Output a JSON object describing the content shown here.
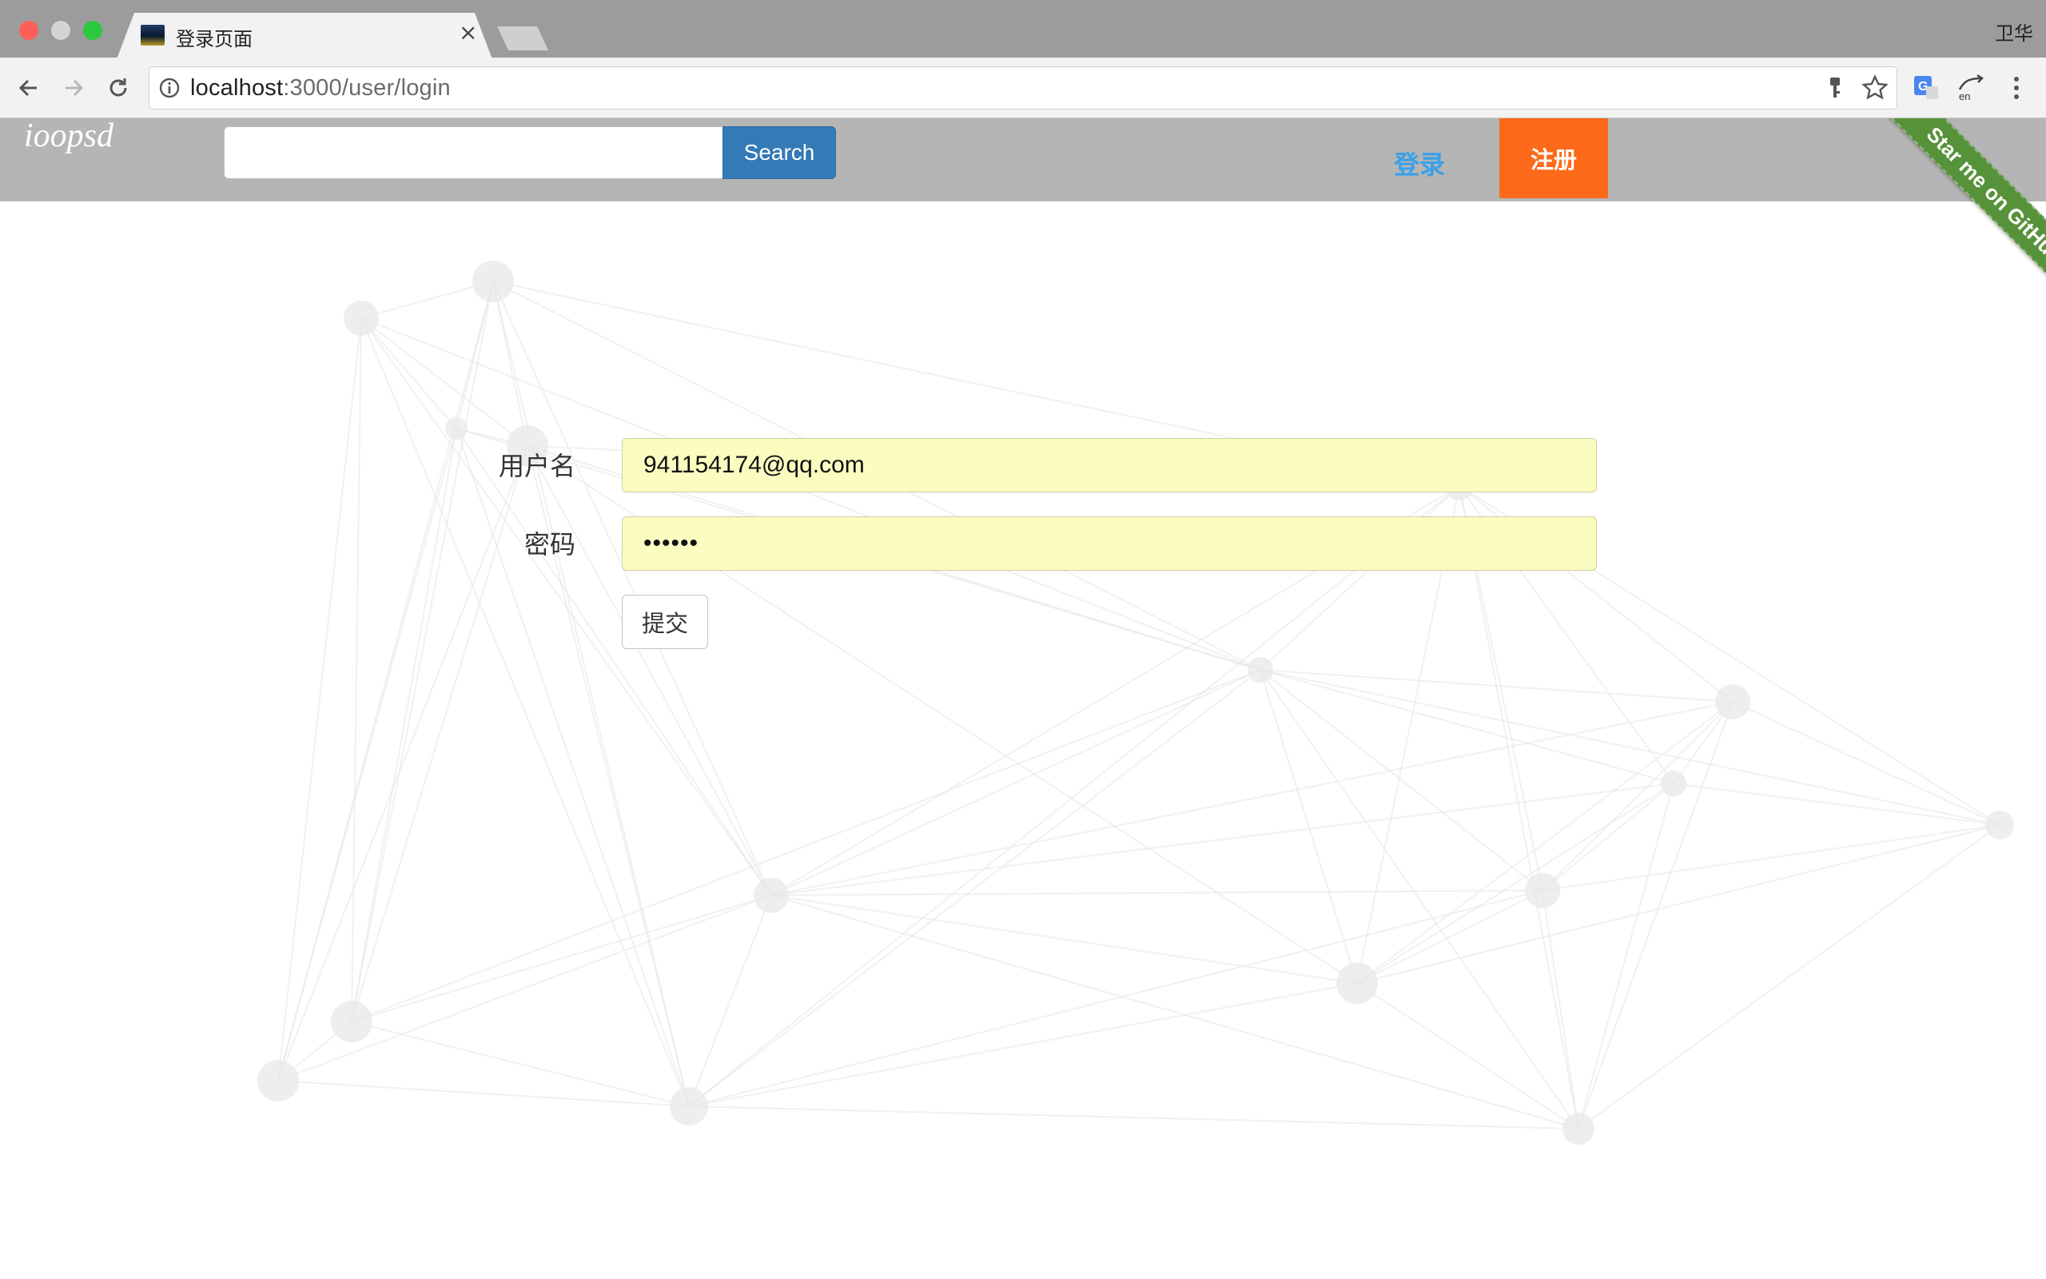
{
  "browser": {
    "tab_title": "登录页面",
    "tab_close": "×",
    "profile_name": "卫华",
    "url_host": "localhost",
    "url_path": ":3000/user/login"
  },
  "navbar": {
    "brand": "ioopsd",
    "search_button": "Search",
    "search_placeholder": "",
    "login_link": "登录",
    "register_button": "注册",
    "github_ribbon": "Star me on GitHub"
  },
  "form": {
    "username_label": "用户名",
    "username_value": "941154174@qq.com",
    "password_label": "密码",
    "password_value": "••••••",
    "submit_label": "提交"
  },
  "colors": {
    "navbar_bg": "#b5b5b5",
    "search_button_bg": "#337ab7",
    "login_link": "#3aa0e8",
    "register_bg": "#fd6a1a",
    "ribbon_bg": "#56923a",
    "autofill_bg": "#fafcc0"
  }
}
